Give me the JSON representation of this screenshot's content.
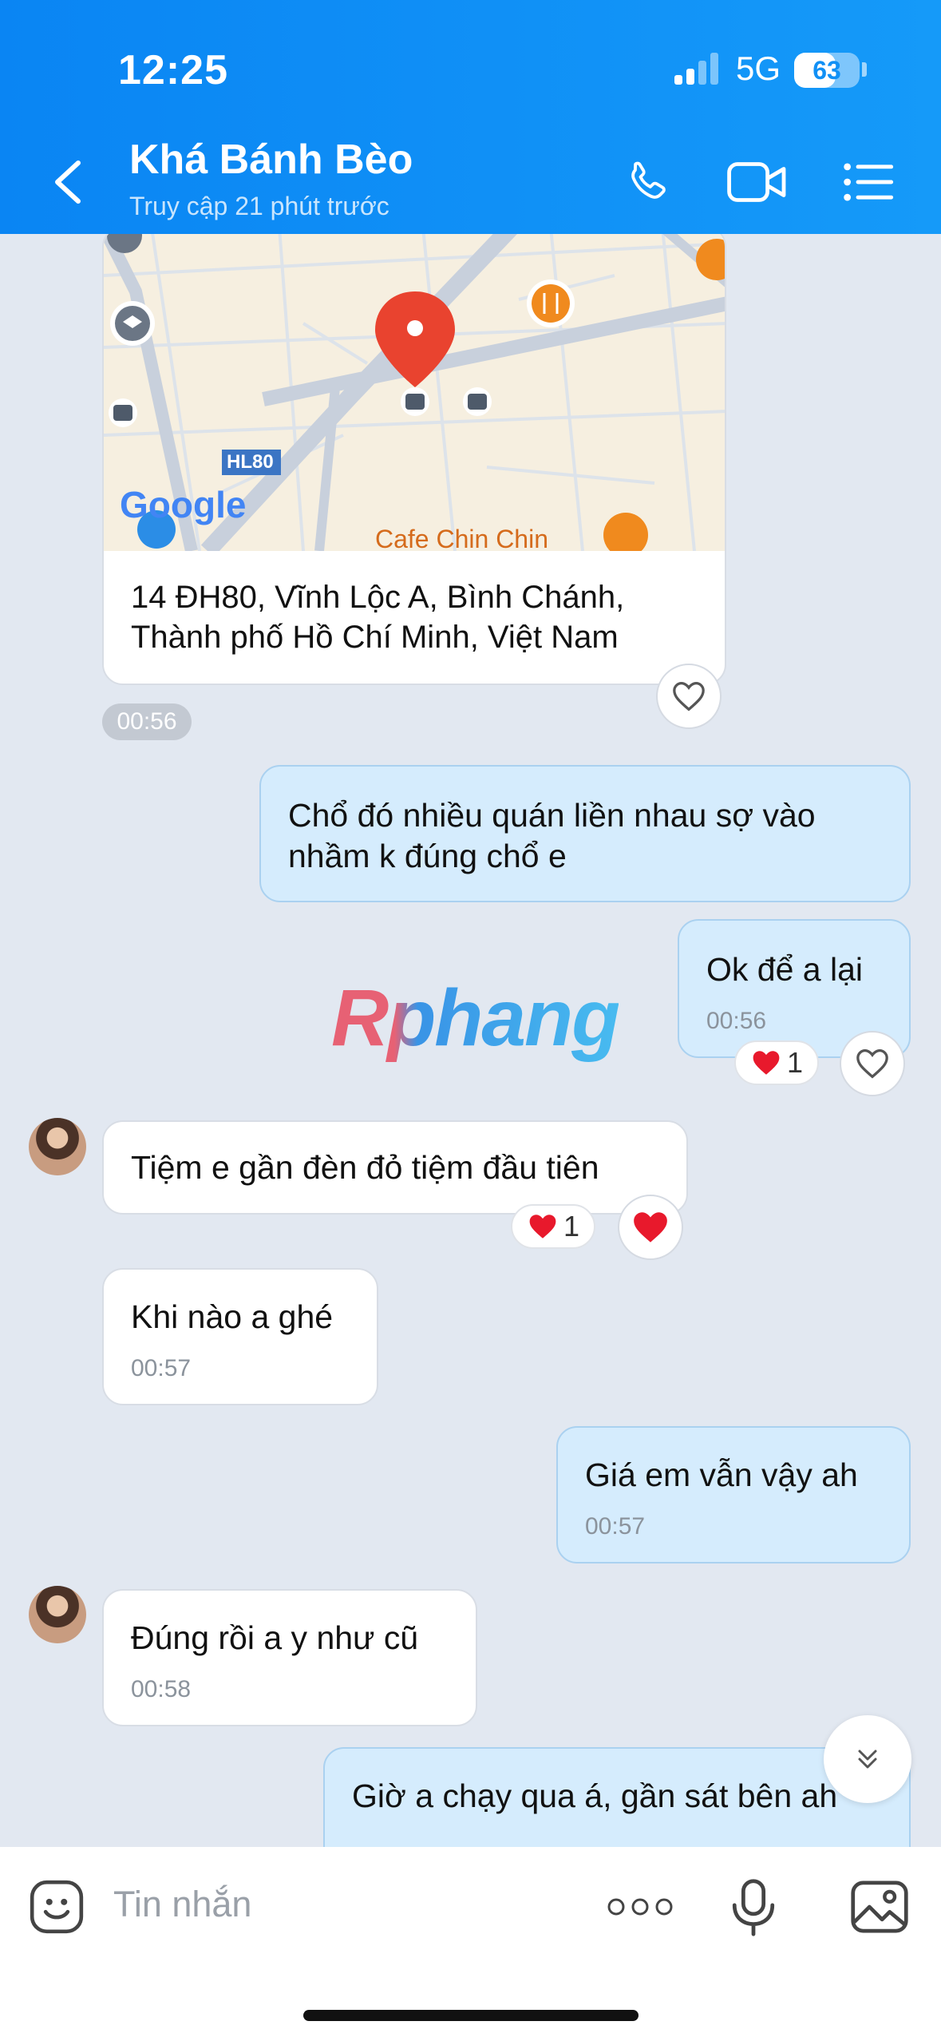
{
  "status_bar": {
    "time": "12:25",
    "network": "5G",
    "battery": "63",
    "battery_level": 0.63
  },
  "header": {
    "contact_name": "Khá Bánh Bèo",
    "last_seen": "Truy cập 21 phút trước"
  },
  "location_message": {
    "map_labels": {
      "road": "HL80",
      "place": "Cafe Chin Chin",
      "logo": "Google"
    },
    "address": "14 ĐH80, Vĩnh Lộc A, Bình Chánh, Thành phố Hồ Chí Minh, Việt Nam",
    "time": "00:56"
  },
  "messages": [
    {
      "direction": "out",
      "text": "Chổ đó nhiều quán liền nhau sợ vào nhầm k đúng chổ e"
    },
    {
      "direction": "out",
      "text": "Ok để a lại",
      "time": "00:56",
      "reaction_count": "1"
    },
    {
      "direction": "in",
      "text": "Tiệm e gần đèn đỏ tiệm đầu tiên",
      "reaction_count": "1"
    },
    {
      "direction": "in",
      "text": "Khi nào a ghé",
      "time": "00:57"
    },
    {
      "direction": "out",
      "text": "Giá em vẫn vậy ah",
      "time": "00:57"
    },
    {
      "direction": "in",
      "text": "Đúng rồi a y như cũ",
      "time": "00:58"
    },
    {
      "direction": "out",
      "text": "Giờ a chạy qua á, gần sát bên ah"
    }
  ],
  "watermark": "Rphang",
  "composer": {
    "placeholder": "Tin nhắn"
  },
  "colors": {
    "header": "#0a85f3",
    "outgoing": "#d5ecfd",
    "incoming": "#ffffff",
    "chat_bg": "#e2e8f1",
    "heart": "#e8192c"
  }
}
